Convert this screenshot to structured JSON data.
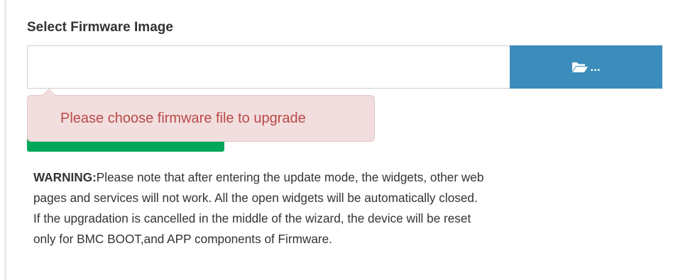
{
  "firmware": {
    "label": "Select Firmware Image",
    "file_input": {
      "value": "",
      "placeholder": ""
    },
    "browse_button": {
      "icon": "folder-open-icon",
      "label": "..."
    },
    "upload_button": {
      "label": ""
    },
    "tooltip": {
      "message": "Please choose firmware file to upgrade"
    },
    "warning": {
      "prefix": "WARNING:",
      "lines": [
        "Please note that after entering the update mode, the widgets, other web",
        "pages and services will not work. All the open widgets will be automatically closed.",
        "If the upgradation is cancelled in the middle of the wizard, the device will be reset",
        "only for BMC BOOT,and APP components of Firmware."
      ]
    }
  },
  "colors": {
    "browse_button": "#3c8dbc",
    "upload_button": "#00a65a",
    "tooltip_bg": "#f2dede",
    "tooltip_text": "#b94a48"
  }
}
